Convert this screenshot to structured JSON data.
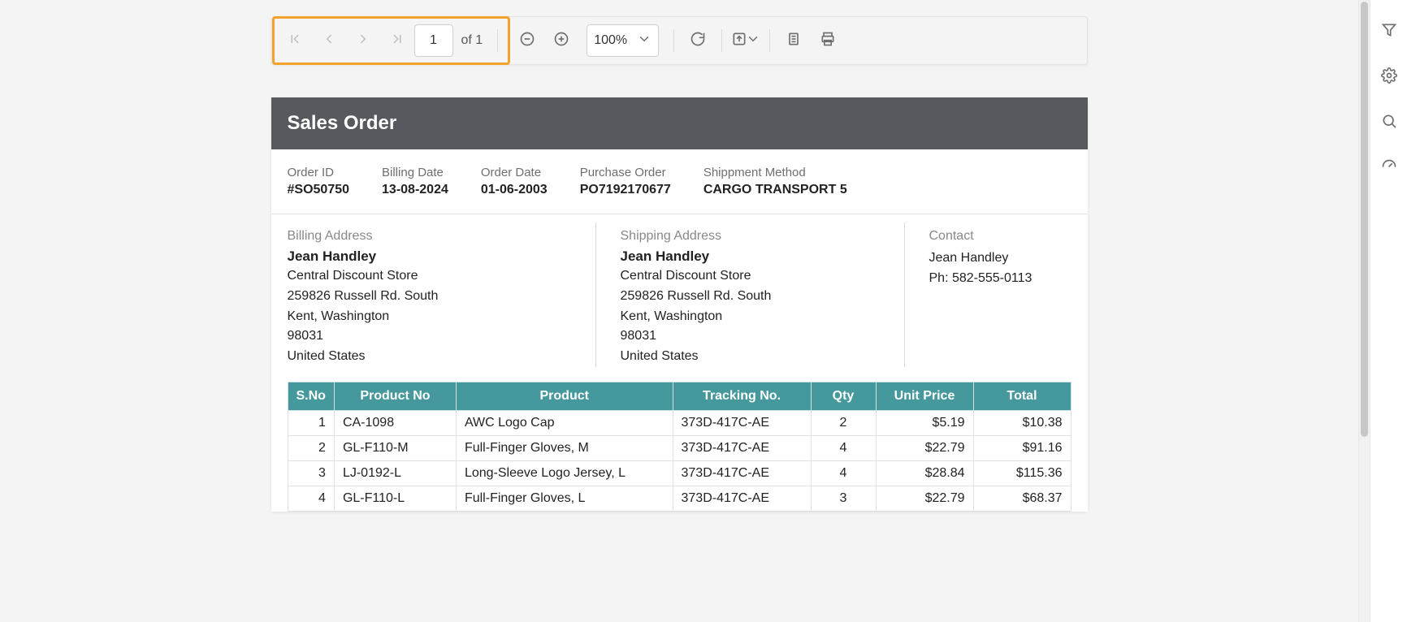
{
  "toolbar": {
    "page_value": "1",
    "page_of_label": "of 1",
    "zoom_label": "100%"
  },
  "doc": {
    "title": "Sales Order",
    "meta": {
      "order_id_label": "Order ID",
      "order_id": "#SO50750",
      "billing_date_label": "Billing Date",
      "billing_date": "13-08-2024",
      "order_date_label": "Order Date",
      "order_date": "01-06-2003",
      "po_label": "Purchase Order",
      "po": "PO7192170677",
      "ship_method_label": "Shippment Method",
      "ship_method": "CARGO TRANSPORT 5"
    },
    "billing_address": {
      "title": "Billing Address",
      "name": "Jean Handley",
      "store": "Central Discount Store",
      "street": "259826 Russell Rd. South",
      "city": "Kent, Washington",
      "zip": "98031",
      "country": "United States"
    },
    "shipping_address": {
      "title": "Shipping Address",
      "name": "Jean Handley",
      "store": "Central Discount Store",
      "street": "259826 Russell Rd. South",
      "city": "Kent, Washington",
      "zip": "98031",
      "country": "United States"
    },
    "contact": {
      "title": "Contact",
      "name": "Jean Handley",
      "phone": "Ph: 582-555-0113"
    },
    "table": {
      "headers": {
        "sno": "S.No",
        "pno": "Product No",
        "product": "Product",
        "tracking": "Tracking No.",
        "qty": "Qty",
        "unit": "Unit Price",
        "total": "Total"
      },
      "rows": [
        {
          "sno": "1",
          "pno": "CA-1098",
          "product": "AWC Logo Cap",
          "tracking": "373D-417C-AE",
          "qty": "2",
          "unit": "$5.19",
          "total": "$10.38"
        },
        {
          "sno": "2",
          "pno": "GL-F110-M",
          "product": "Full-Finger Gloves, M",
          "tracking": "373D-417C-AE",
          "qty": "4",
          "unit": "$22.79",
          "total": "$91.16"
        },
        {
          "sno": "3",
          "pno": "LJ-0192-L",
          "product": "Long-Sleeve Logo Jersey, L",
          "tracking": "373D-417C-AE",
          "qty": "4",
          "unit": "$28.84",
          "total": "$115.36"
        },
        {
          "sno": "4",
          "pno": "GL-F110-L",
          "product": "Full-Finger Gloves, L",
          "tracking": "373D-417C-AE",
          "qty": "3",
          "unit": "$22.79",
          "total": "$68.37"
        }
      ]
    }
  }
}
